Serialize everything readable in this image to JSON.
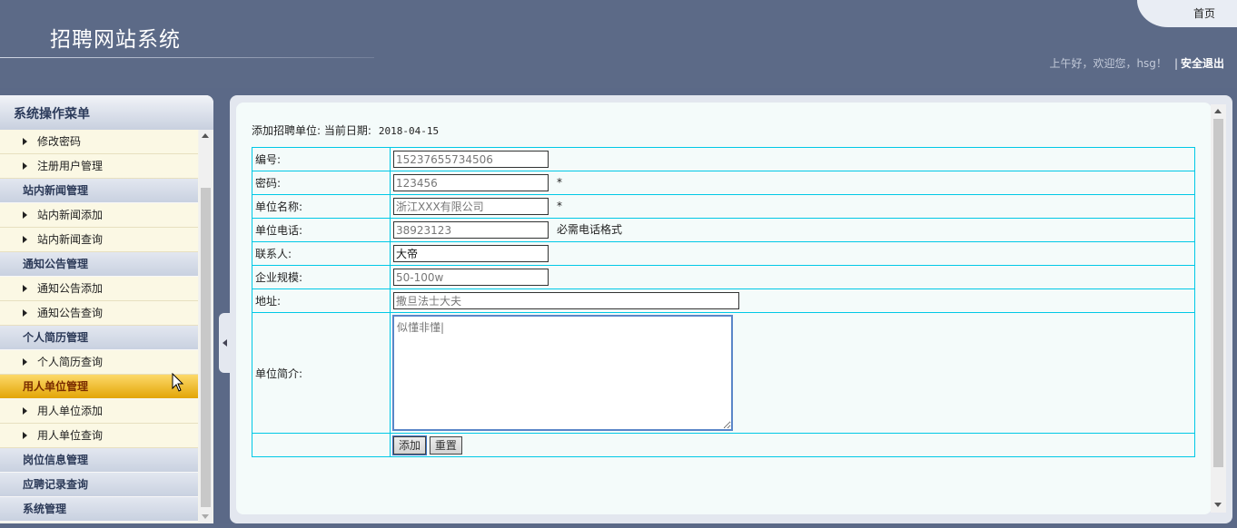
{
  "header": {
    "title": "招聘网站系统",
    "home_label": "首页",
    "greeting": "上午好，欢迎您，hsg！",
    "separator": "|",
    "logout_label": "安全退出"
  },
  "sidebar": {
    "title": "系统操作菜单",
    "items": [
      {
        "type": "item",
        "label": "修改密码"
      },
      {
        "type": "item",
        "label": "注册用户管理"
      },
      {
        "type": "group",
        "label": "站内新闻管理"
      },
      {
        "type": "item",
        "label": "站内新闻添加"
      },
      {
        "type": "item",
        "label": "站内新闻查询"
      },
      {
        "type": "group",
        "label": "通知公告管理"
      },
      {
        "type": "item",
        "label": "通知公告添加"
      },
      {
        "type": "item",
        "label": "通知公告查询"
      },
      {
        "type": "group",
        "label": "个人简历管理"
      },
      {
        "type": "item",
        "label": "个人简历查询"
      },
      {
        "type": "group",
        "label": "用人单位管理",
        "active": true
      },
      {
        "type": "item",
        "label": "用人单位添加"
      },
      {
        "type": "item",
        "label": "用人单位查询"
      },
      {
        "type": "group",
        "label": "岗位信息管理"
      },
      {
        "type": "group",
        "label": "应聘记录查询"
      },
      {
        "type": "group",
        "label": "系统管理"
      }
    ]
  },
  "form": {
    "caption": "添加招聘单位:  当前日期:",
    "date": "2018-04-15",
    "fields": {
      "id": {
        "label": "编号:",
        "value": "15237655734506"
      },
      "password": {
        "label": "密码:",
        "value": "123456",
        "note": "*"
      },
      "name": {
        "label": "单位名称:",
        "value": "浙江XXX有限公司",
        "note": "*"
      },
      "phone": {
        "label": "单位电话:",
        "value": "38923123",
        "note": "必需电话格式"
      },
      "contact": {
        "label": "联系人:",
        "value": "大帝"
      },
      "scale": {
        "label": "企业规模:",
        "value": "50-100w"
      },
      "address": {
        "label": "地址:",
        "value": "撒旦法士大夫"
      },
      "intro": {
        "label": "单位简介:",
        "value": "似懂非懂|"
      }
    },
    "submit_label": "添加",
    "reset_label": "重置"
  },
  "colors": {
    "header_bg": "#5c6a87",
    "active_menu": "#f0b820",
    "table_border": "#00c8e6",
    "panel_bg": "#f4fbfa"
  }
}
